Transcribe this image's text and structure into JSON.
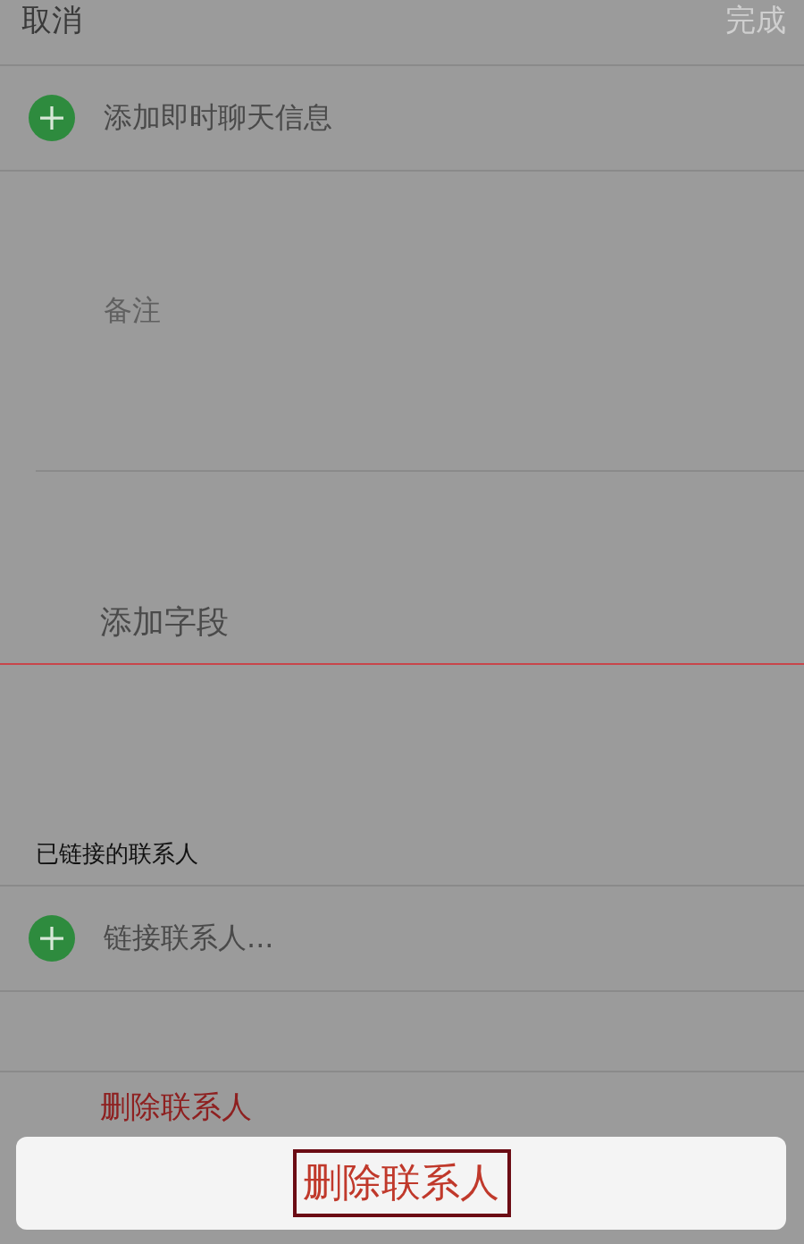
{
  "nav": {
    "cancel": "取消",
    "done": "完成",
    "done_disabled": true
  },
  "rows": [
    {
      "kind": "add",
      "label": "添加即时聊天信息"
    },
    {
      "kind": "note",
      "placeholder": "备注"
    },
    {
      "kind": "field",
      "label": "添加字段"
    },
    {
      "kind": "header",
      "label": "已链接的联系人"
    },
    {
      "kind": "add",
      "label": "链接联系人..."
    },
    {
      "kind": "blank"
    },
    {
      "kind": "danger",
      "label": "删除联系人"
    }
  ],
  "action_sheet": {
    "label": "删除联系人",
    "highlighted": true
  }
}
